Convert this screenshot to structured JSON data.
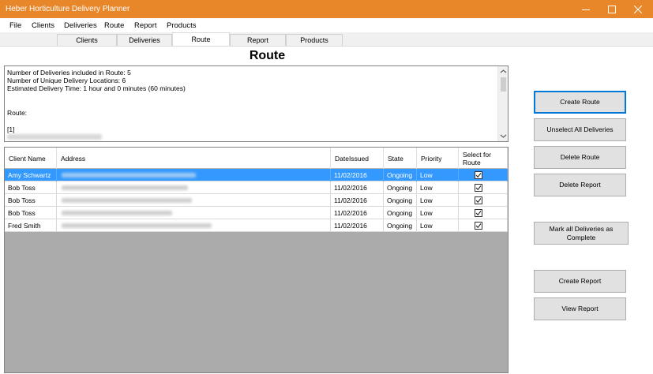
{
  "window": {
    "title": "Heber Horticulture Delivery Planner",
    "minimize_icon": "minimize-icon",
    "maximize_icon": "maximize-icon",
    "close_icon": "close-icon"
  },
  "menu": [
    "File",
    "Clients",
    "Deliveries",
    "Route",
    "Report",
    "Products"
  ],
  "tabs": [
    {
      "label": "Clients",
      "active": false
    },
    {
      "label": "Deliveries",
      "active": false
    },
    {
      "label": "Route",
      "active": true
    },
    {
      "label": "Report",
      "active": false
    },
    {
      "label": "Products",
      "active": false
    }
  ],
  "page": {
    "heading": "Route"
  },
  "summary": {
    "lines": [
      "Number of Deliveries included in Route: 5",
      "Number of Unique Delivery Locations: 6",
      "Estimated Delivery Time: 1 hour and 0 minutes (60 minutes)",
      "",
      "Route:",
      "",
      "[1]"
    ]
  },
  "grid": {
    "columns": [
      "Client Name",
      "Address",
      "DateIssued",
      "State",
      "Priority",
      "Select for Route"
    ],
    "rows": [
      {
        "client": "Amy Schwartz",
        "date": "11/02/2016",
        "state": "Ongoing",
        "priority": "Low",
        "selected_for_route": true,
        "highlighted": true
      },
      {
        "client": "Bob Toss",
        "date": "11/02/2016",
        "state": "Ongoing",
        "priority": "Low",
        "selected_for_route": true,
        "highlighted": false
      },
      {
        "client": "Bob Toss",
        "date": "11/02/2016",
        "state": "Ongoing",
        "priority": "Low",
        "selected_for_route": true,
        "highlighted": false
      },
      {
        "client": "Bob Toss",
        "date": "11/02/2016",
        "state": "Ongoing",
        "priority": "Low",
        "selected_for_route": true,
        "highlighted": false
      },
      {
        "client": "Fred Smith",
        "date": "11/02/2016",
        "state": "Ongoing",
        "priority": "Low",
        "selected_for_route": true,
        "highlighted": false
      }
    ]
  },
  "buttons": {
    "create_route": "Create Route",
    "unselect_all": "Unselect All Deliveries",
    "delete_route": "Delete Route",
    "delete_report": "Delete Report",
    "mark_complete": "Mark all Deliveries as Complete",
    "create_report": "Create Report",
    "view_report": "View Report"
  },
  "colors": {
    "titlebar": "#e8862a",
    "selection": "#3399ff",
    "grid_background": "#ababab"
  }
}
